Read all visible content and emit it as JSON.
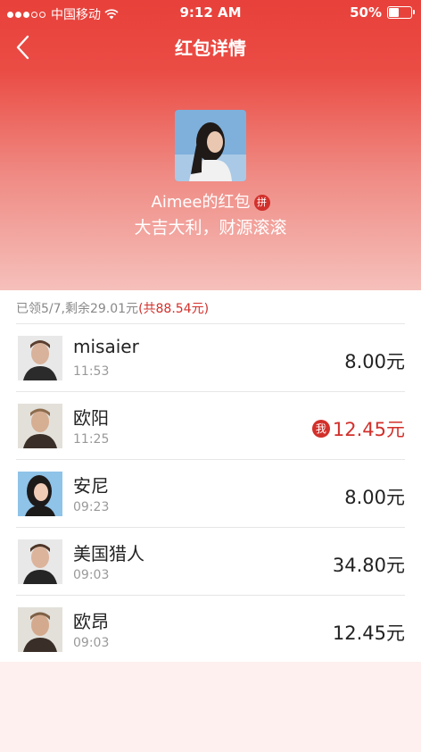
{
  "status_bar": {
    "carrier": "中国移动",
    "time": "9:12 AM",
    "battery_text": "50%",
    "battery_level": 0.5,
    "signal_bars_filled": 3,
    "signal_bars_total": 5
  },
  "nav": {
    "back_icon": "chevron-left-icon",
    "title": "红包详情"
  },
  "sender": {
    "name_line": "Aimee的红包",
    "pin_badge": "拼",
    "blessing": "大吉大利，财源滚滚"
  },
  "summary": {
    "claimed_text": "已领5/7,剩余29.01元",
    "total_text": "(共88.54元)"
  },
  "recipients": [
    {
      "name": "misaier",
      "time": "11:53",
      "amount": "8.00元",
      "mine": false
    },
    {
      "name": "欧阳",
      "time": "11:25",
      "amount": "12.45元",
      "mine": true,
      "me_badge": "我"
    },
    {
      "name": "安尼",
      "time": "09:23",
      "amount": "8.00元",
      "mine": false
    },
    {
      "name": "美国猎人",
      "time": "09:03",
      "amount": "34.80元",
      "mine": false
    },
    {
      "name": "欧昂",
      "time": "09:03",
      "amount": "12.45元",
      "mine": false
    }
  ],
  "colors": {
    "accent": "#d2302b",
    "header_top": "#e8403a",
    "header_bottom": "#f6c0bb"
  }
}
